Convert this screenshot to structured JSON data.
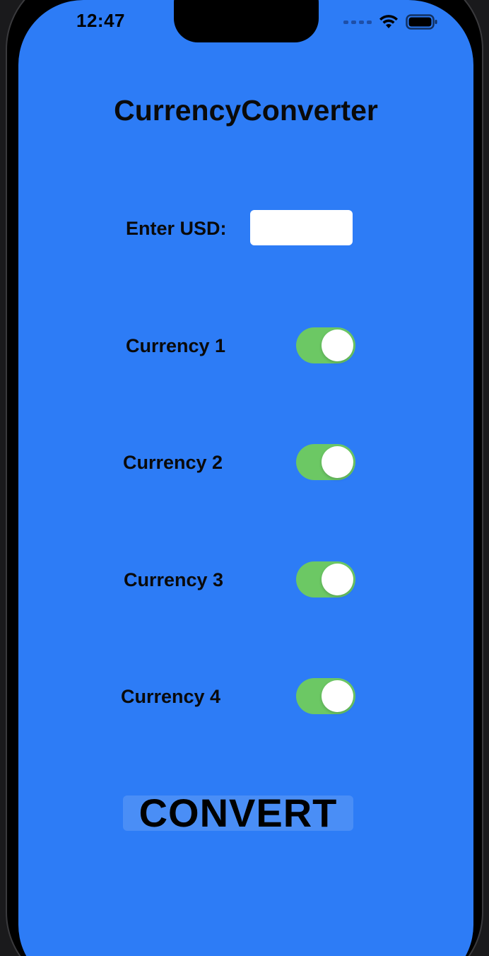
{
  "status_bar": {
    "time": "12:47",
    "icons": [
      "cellular-dots-icon",
      "wifi-icon",
      "battery-icon"
    ]
  },
  "app": {
    "title": "CurrencyConverter",
    "usd_label": "Enter USD:",
    "usd_value": "",
    "currencies": [
      {
        "label": "Currency 1",
        "enabled": true
      },
      {
        "label": "Currency 2",
        "enabled": true
      },
      {
        "label": "Currency 3",
        "enabled": true
      },
      {
        "label": "Currency 4",
        "enabled": true
      }
    ],
    "convert_label": "CONVERT"
  },
  "colors": {
    "background": "#2d7cf6",
    "toggle_on": "#6cc864",
    "button_bg": "#4a8ef6"
  }
}
